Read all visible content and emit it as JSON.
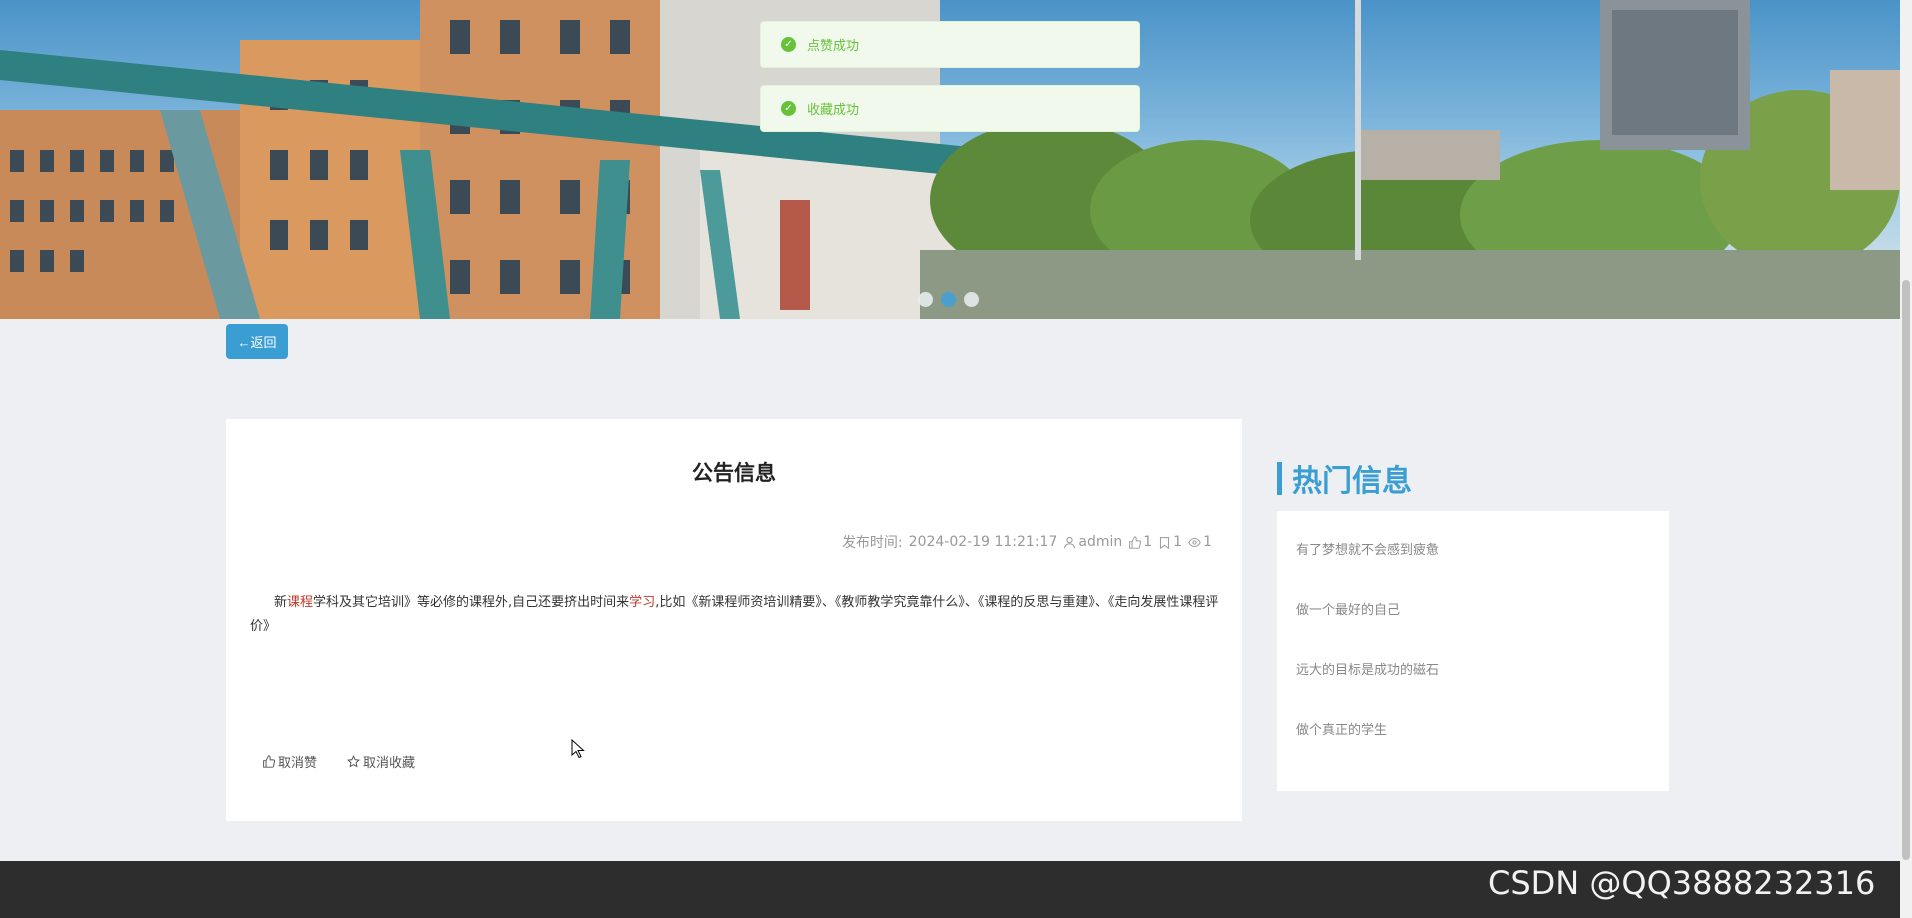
{
  "toasts": [
    {
      "icon": "check-circle-icon",
      "text": "点赞成功"
    },
    {
      "icon": "check-circle-icon",
      "text": "收藏成功"
    }
  ],
  "carousel": {
    "active_index": 1,
    "count": 3
  },
  "back_button": {
    "label": "←返回"
  },
  "article": {
    "title": "公告信息",
    "meta": {
      "publish_label": "发布时间:",
      "publish_time": "2024-02-19 11:21:17",
      "author": "admin",
      "likes": "1",
      "favorites": "1",
      "views": "1"
    },
    "content": {
      "part1": "新",
      "hl1": "课程",
      "part2": "学科及其它培训》等必修的课程外,自己还要挤出时间来",
      "hl2": "学习",
      "part3": ",比如《新课程师资培训精要》、《教师教学究竟靠什么》、《课程的反思与重建》、《走向发展性课程评价》"
    },
    "actions": {
      "unlike": "取消赞",
      "unfavorite": "取消收藏"
    }
  },
  "hot_info": {
    "title": "热门信息",
    "items": [
      "有了梦想就不会感到疲惫",
      "做一个最好的自己",
      "远大的目标是成功的磁石",
      "做个真正的学生"
    ]
  },
  "watermark": "CSDN @QQ3888232316",
  "colors": {
    "accent": "#3a9ed3",
    "success": "#67c23a",
    "footer": "#2d2d2d"
  }
}
